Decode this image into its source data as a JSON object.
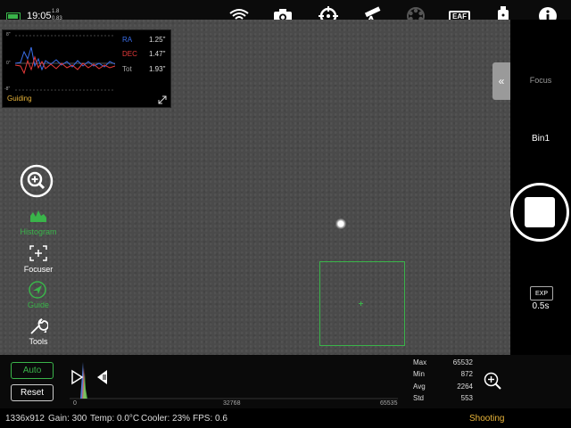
{
  "status_top": {
    "time": "19:05",
    "stat_a": "1.8",
    "stat_b": "0.83"
  },
  "top_icons": [
    "wifi-icon",
    "camera-icon",
    "mount-crosshair-icon",
    "telescope-icon",
    "filter-wheel-icon",
    "eaf-icon",
    "storage-icon",
    "info-icon"
  ],
  "eaf_label": "EAF",
  "guiding": {
    "axis_top": "8\"",
    "axis_mid": "0\"",
    "axis_bot": "-8\"",
    "ra_label": "RA",
    "ra_value": "1.25\"",
    "dec_label": "DEC",
    "dec_value": "1.47\"",
    "tot_label": "Tot",
    "tot_value": "1.93\"",
    "title": "Guiding",
    "colors": {
      "ra": "#3a6ee8",
      "dec": "#e83a3a",
      "title": "#e8b43a"
    }
  },
  "tools": {
    "histogram": "Histogram",
    "focuser": "Focuser",
    "guide": "Guide",
    "tools": "Tools"
  },
  "right_panel": {
    "focus": "Focus",
    "bin": "Bin1",
    "exp_badge": "EXP",
    "exp_value": "0.5s"
  },
  "histogram_panel": {
    "auto": "Auto",
    "reset": "Reset",
    "tick_min": "0",
    "tick_mid": "32768",
    "tick_max": "65535"
  },
  "stats": {
    "max_label": "Max",
    "max_value": "65532",
    "min_label": "Min",
    "min_value": "872",
    "avg_label": "Avg",
    "avg_value": "2264",
    "std_label": "Std",
    "std_value": "553"
  },
  "statusbar": {
    "resolution": "1336x912",
    "gain": "Gain: 300",
    "temp": "Temp: 0.0°C",
    "cooler": "Cooler: 23%",
    "fps": "FPS: 0.6",
    "mode": "Shooting",
    "mode_color": "#e8b43a"
  }
}
